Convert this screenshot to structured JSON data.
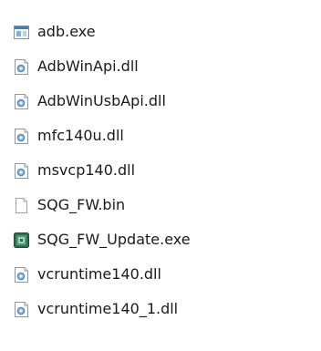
{
  "explorer": {
    "files": [
      {
        "name": "adb.exe",
        "icon": "exe-window-icon"
      },
      {
        "name": "AdbWinApi.dll",
        "icon": "dll-gear-icon"
      },
      {
        "name": "AdbWinUsbApi.dll",
        "icon": "dll-gear-icon"
      },
      {
        "name": "mfc140u.dll",
        "icon": "dll-gear-icon"
      },
      {
        "name": "msvcp140.dll",
        "icon": "dll-gear-icon"
      },
      {
        "name": "SQG_FW.bin",
        "icon": "blank-file-icon"
      },
      {
        "name": "SQG_FW_Update.exe",
        "icon": "app-green-icon"
      },
      {
        "name": "vcruntime140.dll",
        "icon": "dll-gear-icon"
      },
      {
        "name": "vcruntime140_1.dll",
        "icon": "dll-gear-icon"
      }
    ]
  },
  "colors": {
    "text": "#1a1a1a",
    "dll_accent": "#4d86c8",
    "exe_accent": "#3c7fc4",
    "app_green": "#2f6f50"
  }
}
